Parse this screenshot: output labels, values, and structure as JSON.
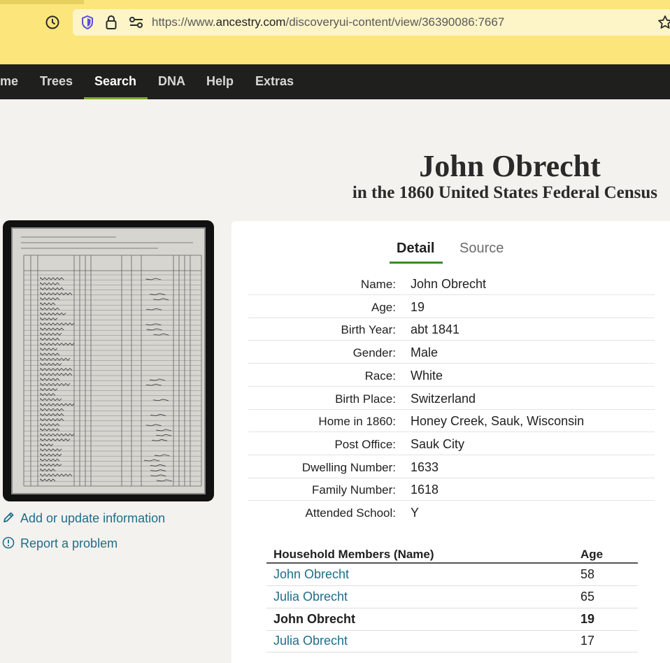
{
  "browser": {
    "url_prefix": "https://www.",
    "url_domain": "ancestry.com",
    "url_path": "/discoveryui-content/view/36390086:7667"
  },
  "nav": {
    "items": [
      "me",
      "Trees",
      "Search",
      "DNA",
      "Help",
      "Extras"
    ],
    "active": "Search",
    "accent_color": "#7fa822"
  },
  "record": {
    "title": "John Obrecht",
    "subtitle": "in the 1860 United States Federal Census"
  },
  "tabs": {
    "detail": "Detail",
    "source": "Source"
  },
  "details": [
    {
      "label": "Name:",
      "value": "John Obrecht"
    },
    {
      "label": "Age:",
      "value": "19"
    },
    {
      "label": "Birth Year:",
      "value": "abt 1841"
    },
    {
      "label": "Gender:",
      "value": "Male"
    },
    {
      "label": "Race:",
      "value": "White"
    },
    {
      "label": "Birth Place:",
      "value": "Switzerland"
    },
    {
      "label": "Home in 1860:",
      "value": "Honey Creek, Sauk, Wisconsin"
    },
    {
      "label": "Post Office:",
      "value": "Sauk City"
    },
    {
      "label": "Dwelling Number:",
      "value": "1633"
    },
    {
      "label": "Family Number:",
      "value": "1618"
    },
    {
      "label": "Attended School:",
      "value": "Y"
    }
  ],
  "sidebar": {
    "add_update": "Add or update information",
    "report": "Report a problem"
  },
  "household": {
    "header_name": "Household Members (Name)",
    "header_age": "Age",
    "rows": [
      {
        "name": "John Obrecht",
        "age": "58"
      },
      {
        "name": "Julia Obrecht",
        "age": "65"
      },
      {
        "name": "John Obrecht",
        "age": "19"
      },
      {
        "name": "Julia Obrecht",
        "age": "17"
      }
    ]
  }
}
